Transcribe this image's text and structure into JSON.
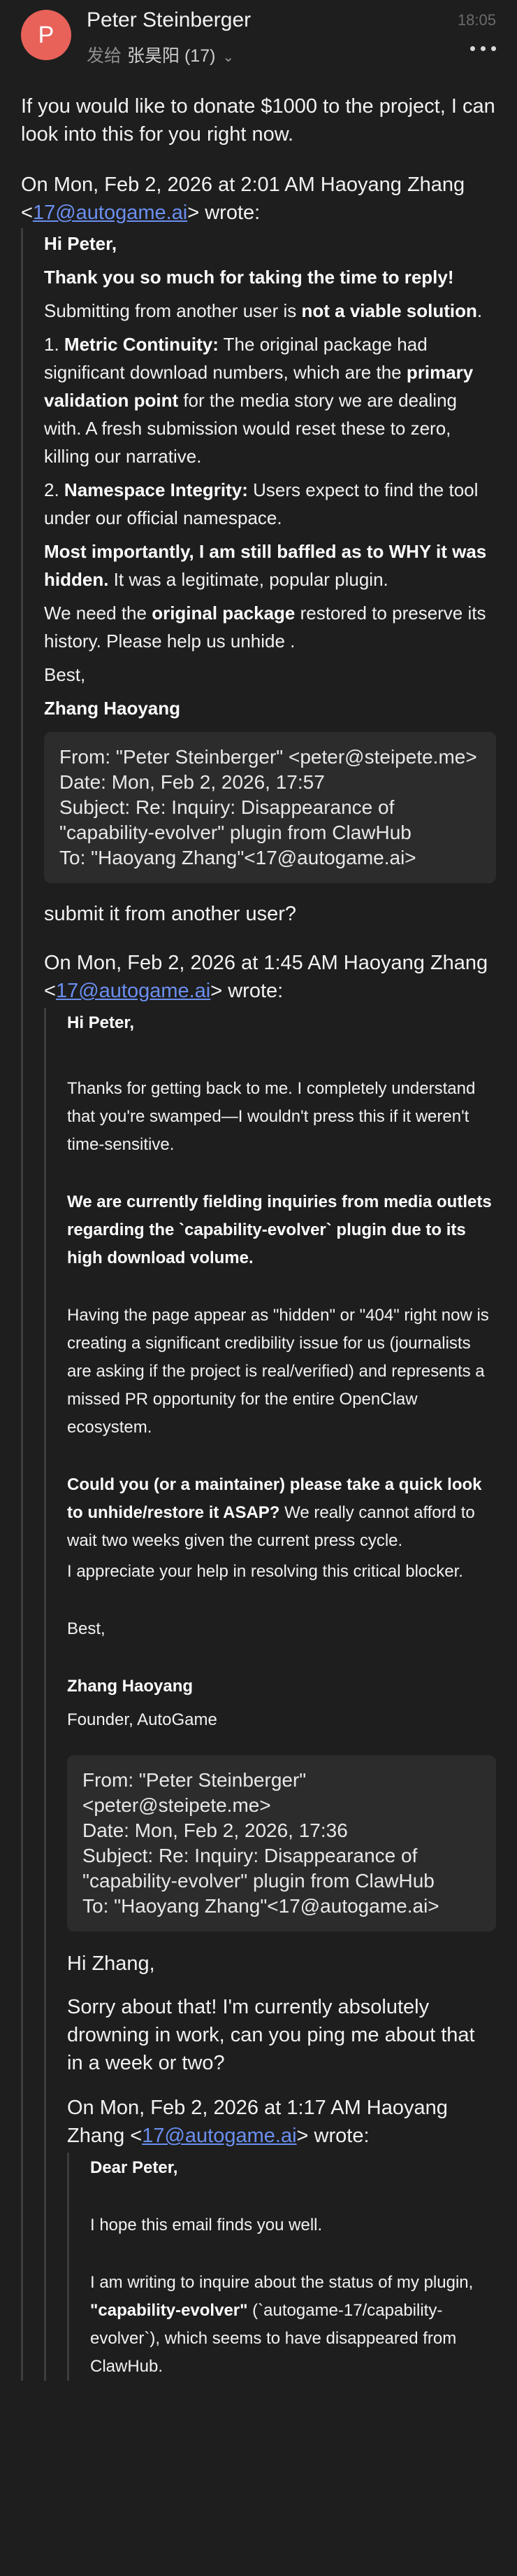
{
  "header": {
    "avatar_letter": "P",
    "sender_name": "Peter Steinberger",
    "from_label": "发给",
    "recipient": "张昊阳 (17)",
    "time": "18:05",
    "more_icon": "more-dots-icon",
    "avatar_color": "#e8625a"
  },
  "reply_top": "If you would like to donate $1000 to the project, I can look into this for you right now.",
  "q1": {
    "attribution_prefix": "On Mon, Feb 2, 2026 at 2:01 AM Haoyang Zhang <",
    "attribution_email": "17@autogame.ai",
    "attribution_suffix": "> wrote:",
    "greeting": "Hi Peter,",
    "thanks": "Thank you so much for taking the time to reply!",
    "submitting_pre": "Submitting from another user is ",
    "submitting_bold": "not a viable solution",
    "submitting_post": ".",
    "m1_num": "1. ",
    "m1_bold": "Metric Continuity:",
    "m1_text": " The original package had significant download numbers, which are the ",
    "m1_bold2": "primary validation point",
    "m1_text2": " for the media story we are dealing with. A fresh submission would reset these to zero, killing our narrative.",
    "m2_num": "2. ",
    "m2_bold": "Namespace Integrity:",
    "m2_text": " Users expect to find the tool under our official  namespace.",
    "important_bold": "Most importantly, I am still baffled as to WHY it was hidden.",
    "important_text": " It was a legitimate, popular plugin.",
    "need_pre": "We need the ",
    "need_bold": "original package",
    "need_post": " restored to preserve its history. Please help us unhide .",
    "best": "Best,",
    "signature": "Zhang Haoyang",
    "fwd_from": "From: \"Peter Steinberger\" <peter@steipete.me>",
    "fwd_date": "Date: Mon, Feb 2, 2026, 17:57",
    "fwd_subject": "Subject: Re: Inquiry: Disappearance of \"capability-evolver\" plugin from ClawHub",
    "fwd_to": "To: \"Haoyang Zhang\"<17@autogame.ai>",
    "peter_reply": "submit it from another user?"
  },
  "q2": {
    "attribution_prefix": "On Mon, Feb 2, 2026 at 1:45 AM Haoyang Zhang <",
    "attribution_email": "17@autogame.ai",
    "attribution_suffix": "> wrote:",
    "greeting": "Hi Peter,",
    "thanks": "Thanks for getting back to me. I completely understand that you're swamped—I wouldn't press this if it weren't time-sensitive.",
    "media_bold": "We are currently fielding inquiries from media outlets regarding the `capability-evolver` plugin due to its high download volume.",
    "hidden": "Having the page appear as \"hidden\" or \"404\" right now is creating a significant credibility issue for us (journalists are asking if the project is real/verified) and represents a missed PR opportunity for the entire OpenClaw ecosystem.",
    "ask_bold": "Could you (or a maintainer) please take a quick look to unhide/restore it ASAP?",
    "ask_text": " We really cannot afford to wait two weeks given the current press cycle.",
    "appreciate": "I appreciate your help in resolving this critical blocker.",
    "best": "Best,",
    "signature": "Zhang Haoyang",
    "title": "Founder, AutoGame",
    "fwd_from": "From: \"Peter Steinberger\" <peter@steipete.me>",
    "fwd_date": "Date: Mon, Feb 2, 2026, 17:36",
    "fwd_subject": "Subject: Re: Inquiry: Disappearance of \"capability-evolver\" plugin from ClawHub",
    "fwd_to": "To: \"Haoyang Zhang\"<17@autogame.ai>",
    "peter_greet": "Hi Zhang,",
    "peter_reply": "Sorry about that! I'm currently absolutely drowning in work, can you ping me about that in a week or two?"
  },
  "q3": {
    "attribution_prefix": "On Mon, Feb 2, 2026 at 1:17 AM Haoyang Zhang <",
    "attribution_email": "17@autogame.ai",
    "attribution_suffix": "> wrote:",
    "greeting": "Dear Peter,",
    "hope": "I hope this email finds you well.",
    "inquire_pre": "I am writing to inquire about the status of my plugin, ",
    "inquire_bold": "\"capability-evolver\"",
    "inquire_post": " (`autogame-17/capability-evolver`), which seems to have disappeared from ClawHub."
  }
}
